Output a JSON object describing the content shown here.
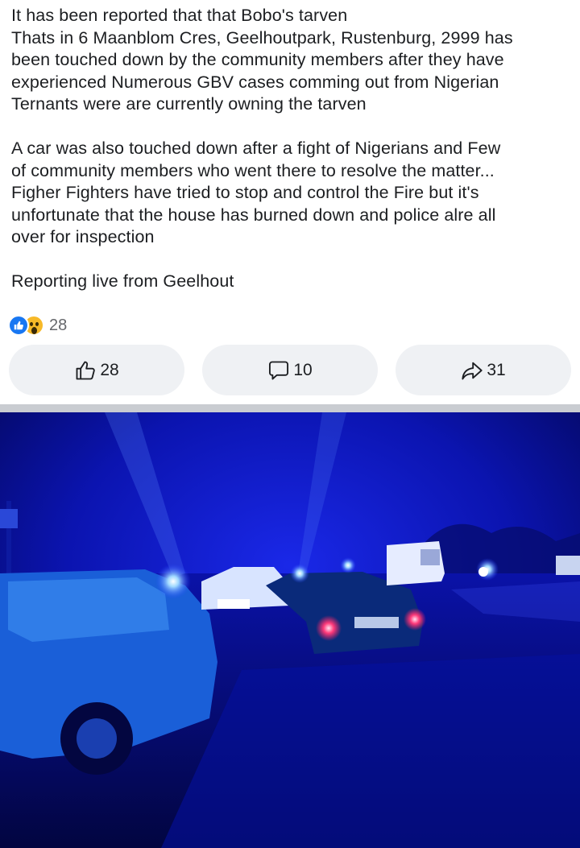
{
  "post": {
    "paragraph_1": "It has been reported that that Bobo's tarven\nThats in 6 Maanblom Cres, Geelhoutpark, Rustenburg, 2999 has\nbeen touched down by the community members after they have\nexperienced Numerous GBV cases comming out from Nigerian\nTernants were are currently owning the tarven",
    "paragraph_2": "A car was also touched down after a fight of Nigerians and Few\nof community members who went there to resolve the matter...\nFigher Fighters have tried to stop and control the Fire but it's\nunfortunate that the house has burned down and police alre all\nover for inspection",
    "paragraph_3": "Reporting live from Geelhout"
  },
  "reactions": {
    "count": "28",
    "types": [
      "like-icon",
      "wow-icon"
    ],
    "like_color": "#1877f2",
    "wow_color": "#f7b928"
  },
  "actions": {
    "like": {
      "count": "28",
      "icon": "thumbs-up-icon"
    },
    "comment": {
      "count": "10",
      "icon": "comment-icon"
    },
    "share": {
      "count": "31",
      "icon": "share-icon"
    }
  },
  "photo": {
    "dominant_color": "#0a14c8"
  }
}
